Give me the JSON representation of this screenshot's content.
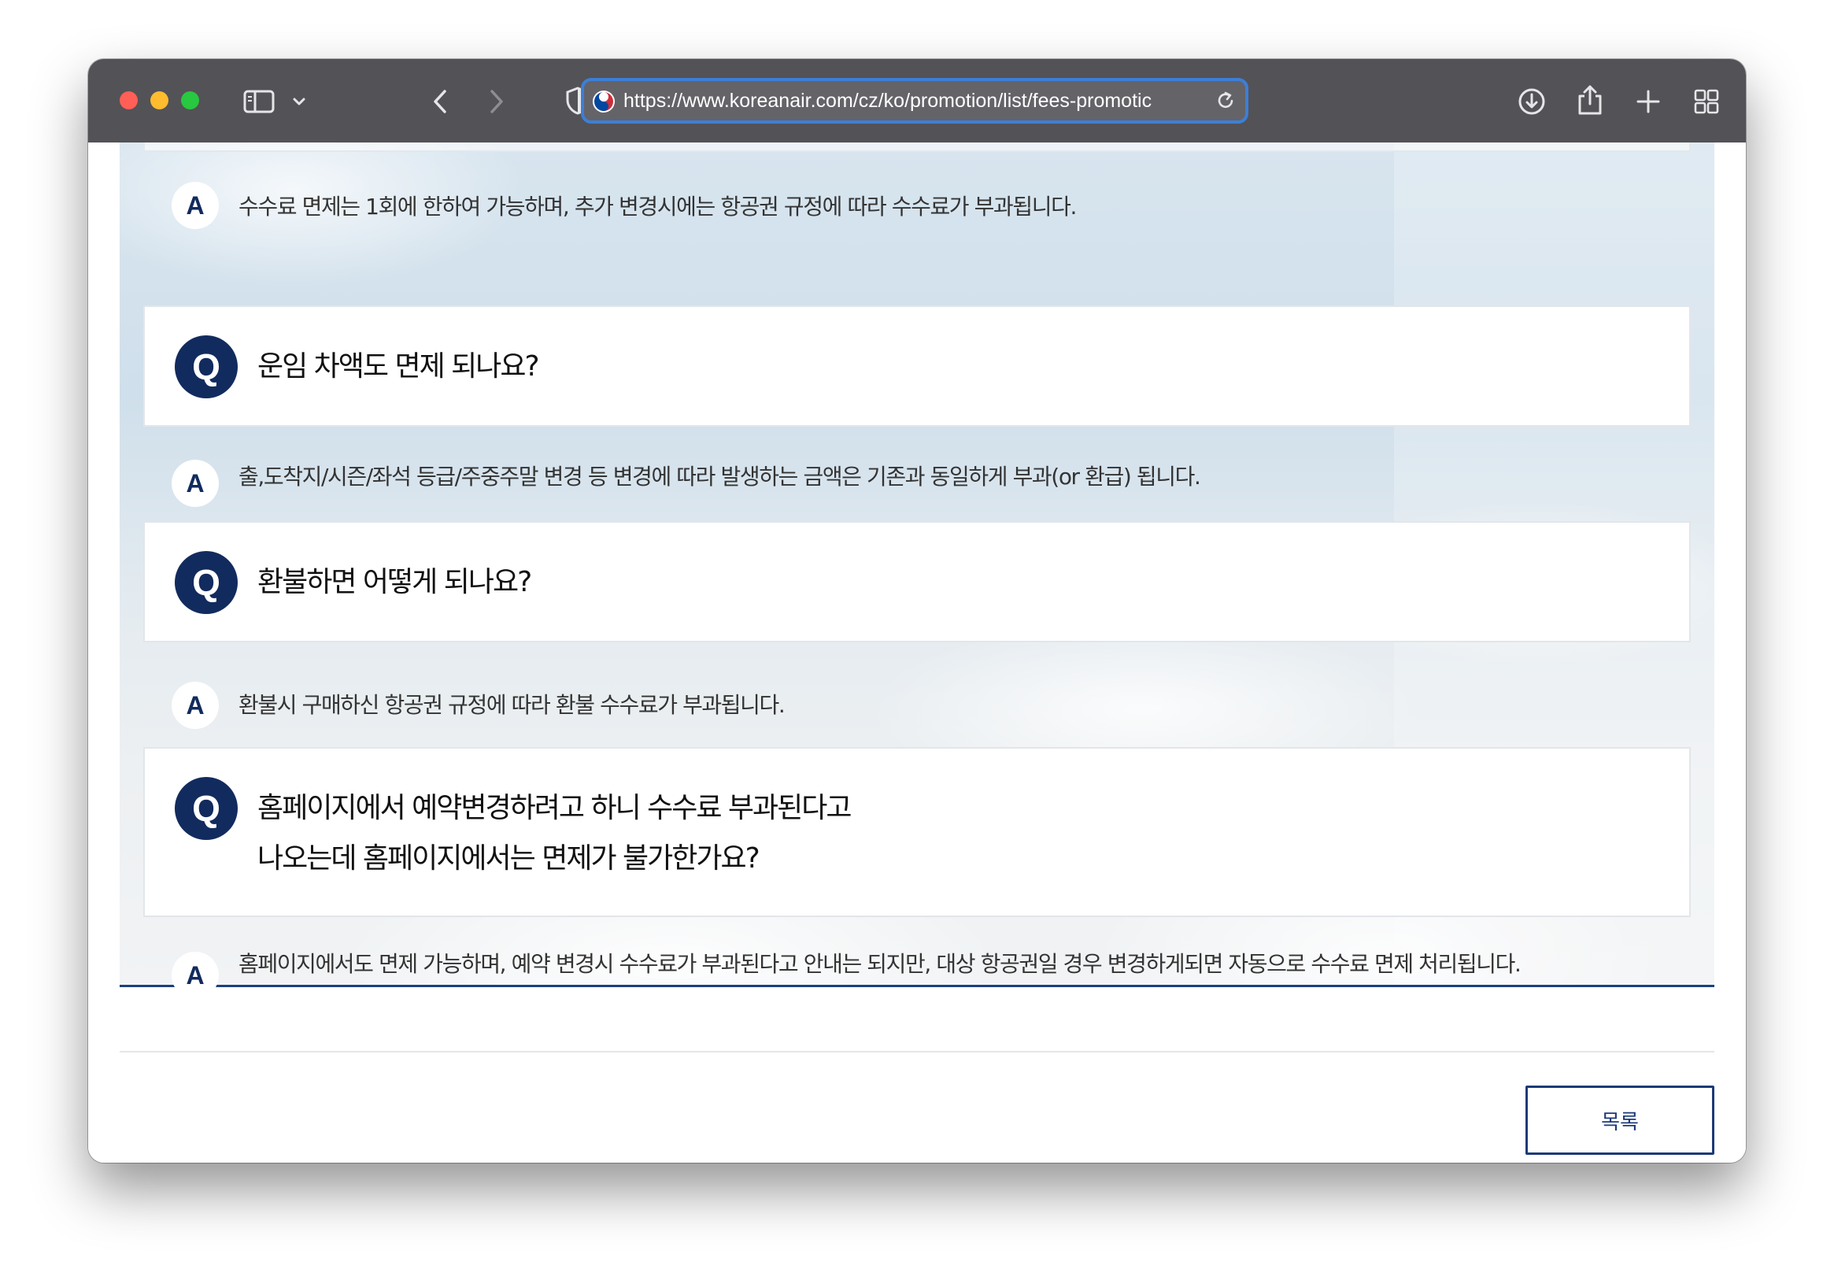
{
  "browser": {
    "url": "https://www.koreanair.com/cz/ko/promotion/list/fees-promotic"
  },
  "faq": [
    {
      "answer": "수수료 면제는 1회에 한하여 가능하며, 추가 변경시에는 항공권 규정에 따라 수수료가 부과됩니다."
    },
    {
      "question_lines": [
        "운임 차액도 면제 되나요?"
      ],
      "answer": "출,도착지/시즌/좌석 등급/주중주말 변경 등 변경에 따라 발생하는 금액은 기존과 동일하게 부과(or 환급) 됩니다."
    },
    {
      "question_lines": [
        "환불하면 어떻게 되나요?"
      ],
      "answer": "환불시 구매하신 항공권 규정에 따라 환불 수수료가 부과됩니다."
    },
    {
      "question_lines": [
        "홈페이지에서 예약변경하려고 하니 수수료 부과된다고",
        "나오는데 홈페이지에서는 면제가 불가한가요?"
      ],
      "answer": "홈페이지에서도 면제 가능하며, 예약 변경시 수수료가 부과된다고 안내는 되지만, 대상 항공권일 경우 변경하게되면 자동으로 수수료 면제 처리됩니다."
    }
  ],
  "badges": {
    "question": "Q",
    "answer": "A"
  },
  "footer": {
    "list_button": "목록"
  },
  "icons": {
    "window_controls": [
      "close",
      "minimize",
      "zoom"
    ],
    "toolbar": [
      "sidebar-icon",
      "chevron-down-icon",
      "back-icon",
      "forward-icon",
      "shield-icon",
      "extension-icon",
      "download-icon",
      "share-icon",
      "plus-icon",
      "tabs-grid-icon"
    ]
  },
  "colors": {
    "brand_navy": "#122b5e",
    "url_focus": "#3d7fd6",
    "titlebar": "#535257"
  }
}
